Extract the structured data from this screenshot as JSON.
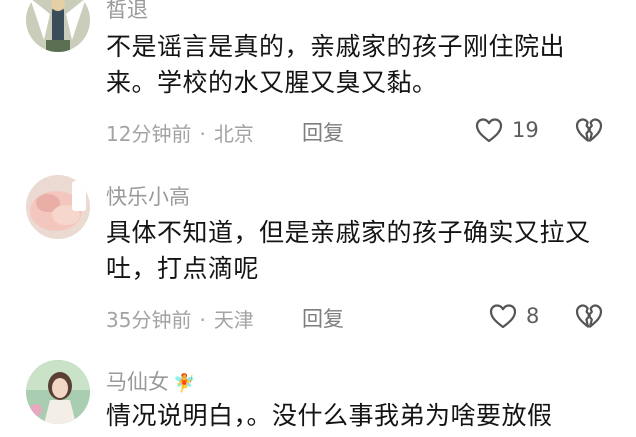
{
  "comments": [
    {
      "username": "皙退",
      "text": "不是谣言是真的，亲戚家的孩子刚住院出来。学校的水又腥又臭又黏。",
      "time": "12分钟前",
      "location": "北京",
      "reply_label": "回复",
      "likes": "19",
      "icons": {
        "like": "heart-outline-icon",
        "dislike": "broken-heart-icon"
      }
    },
    {
      "username": "快乐小高",
      "text": "具体不知道，但是亲戚家的孩子确实又拉又吐，打点滴呢",
      "time": "35分钟前",
      "location": "天津",
      "reply_label": "回复",
      "likes": "8",
      "icons": {
        "like": "heart-outline-icon",
        "dislike": "broken-heart-icon"
      }
    },
    {
      "username": "马仙女",
      "badge_icon": "fairy-emoji-icon",
      "text": "情况说明白，。没什么事我弟为啥要放假"
    }
  ],
  "separator": "·",
  "colors": {
    "text": "#141414",
    "meta": "#a3a3a3",
    "username": "#9a9a9a",
    "icon": "#555555"
  }
}
